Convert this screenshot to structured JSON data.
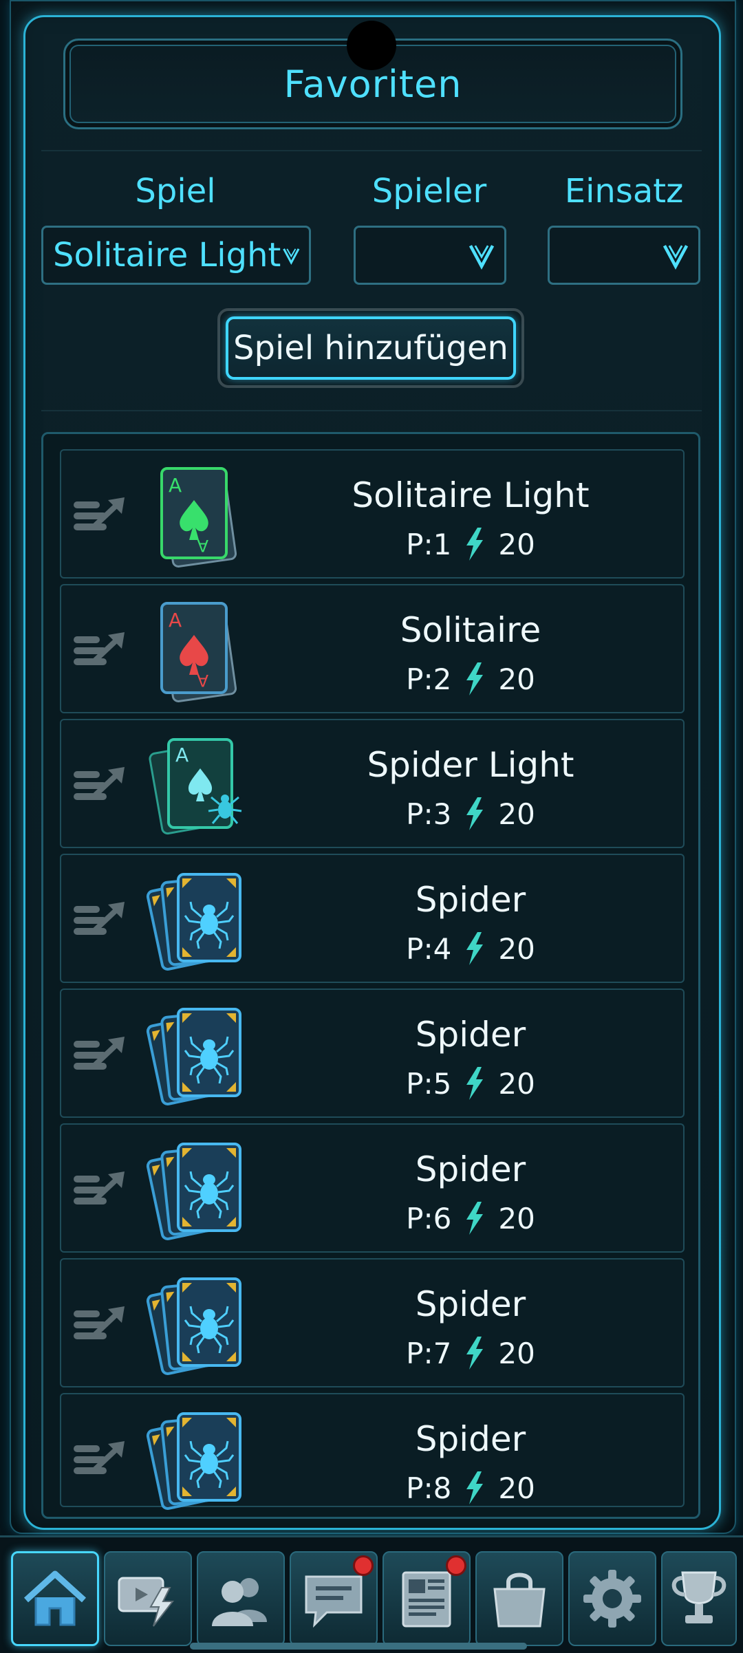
{
  "header": {
    "title": "Favoriten"
  },
  "filters": {
    "game_label": "Spiel",
    "game_value": "Solitaire Light",
    "players_label": "Spieler",
    "players_value": "",
    "stake_label": "Einsatz",
    "stake_value": ""
  },
  "add_button": {
    "label": "Spiel hinzufügen"
  },
  "favorites": [
    {
      "name": "Solitaire Light",
      "players": "P:1",
      "stake": "20",
      "icon": "solitaire-light-icon"
    },
    {
      "name": "Solitaire",
      "players": "P:2",
      "stake": "20",
      "icon": "solitaire-icon"
    },
    {
      "name": "Spider Light",
      "players": "P:3",
      "stake": "20",
      "icon": "spider-light-icon"
    },
    {
      "name": "Spider",
      "players": "P:4",
      "stake": "20",
      "icon": "spider-icon"
    },
    {
      "name": "Spider",
      "players": "P:5",
      "stake": "20",
      "icon": "spider-icon"
    },
    {
      "name": "Spider",
      "players": "P:6",
      "stake": "20",
      "icon": "spider-icon"
    },
    {
      "name": "Spider",
      "players": "P:7",
      "stake": "20",
      "icon": "spider-icon"
    },
    {
      "name": "Spider",
      "players": "P:8",
      "stake": "20",
      "icon": "spider-icon"
    }
  ],
  "nav": [
    {
      "icon": "home-icon",
      "badge": false
    },
    {
      "icon": "tv-bolt-icon",
      "badge": false
    },
    {
      "icon": "friends-icon",
      "badge": false
    },
    {
      "icon": "chat-icon",
      "badge": true
    },
    {
      "icon": "news-icon",
      "badge": true
    },
    {
      "icon": "shop-bag-icon",
      "badge": false
    },
    {
      "icon": "settings-gear-icon",
      "badge": false
    },
    {
      "icon": "trophy-icon",
      "badge": false
    }
  ],
  "colors": {
    "accent": "#4fe0ff",
    "text": "#eef8fb",
    "background": "#0a1c23",
    "badge": "#e03030"
  }
}
